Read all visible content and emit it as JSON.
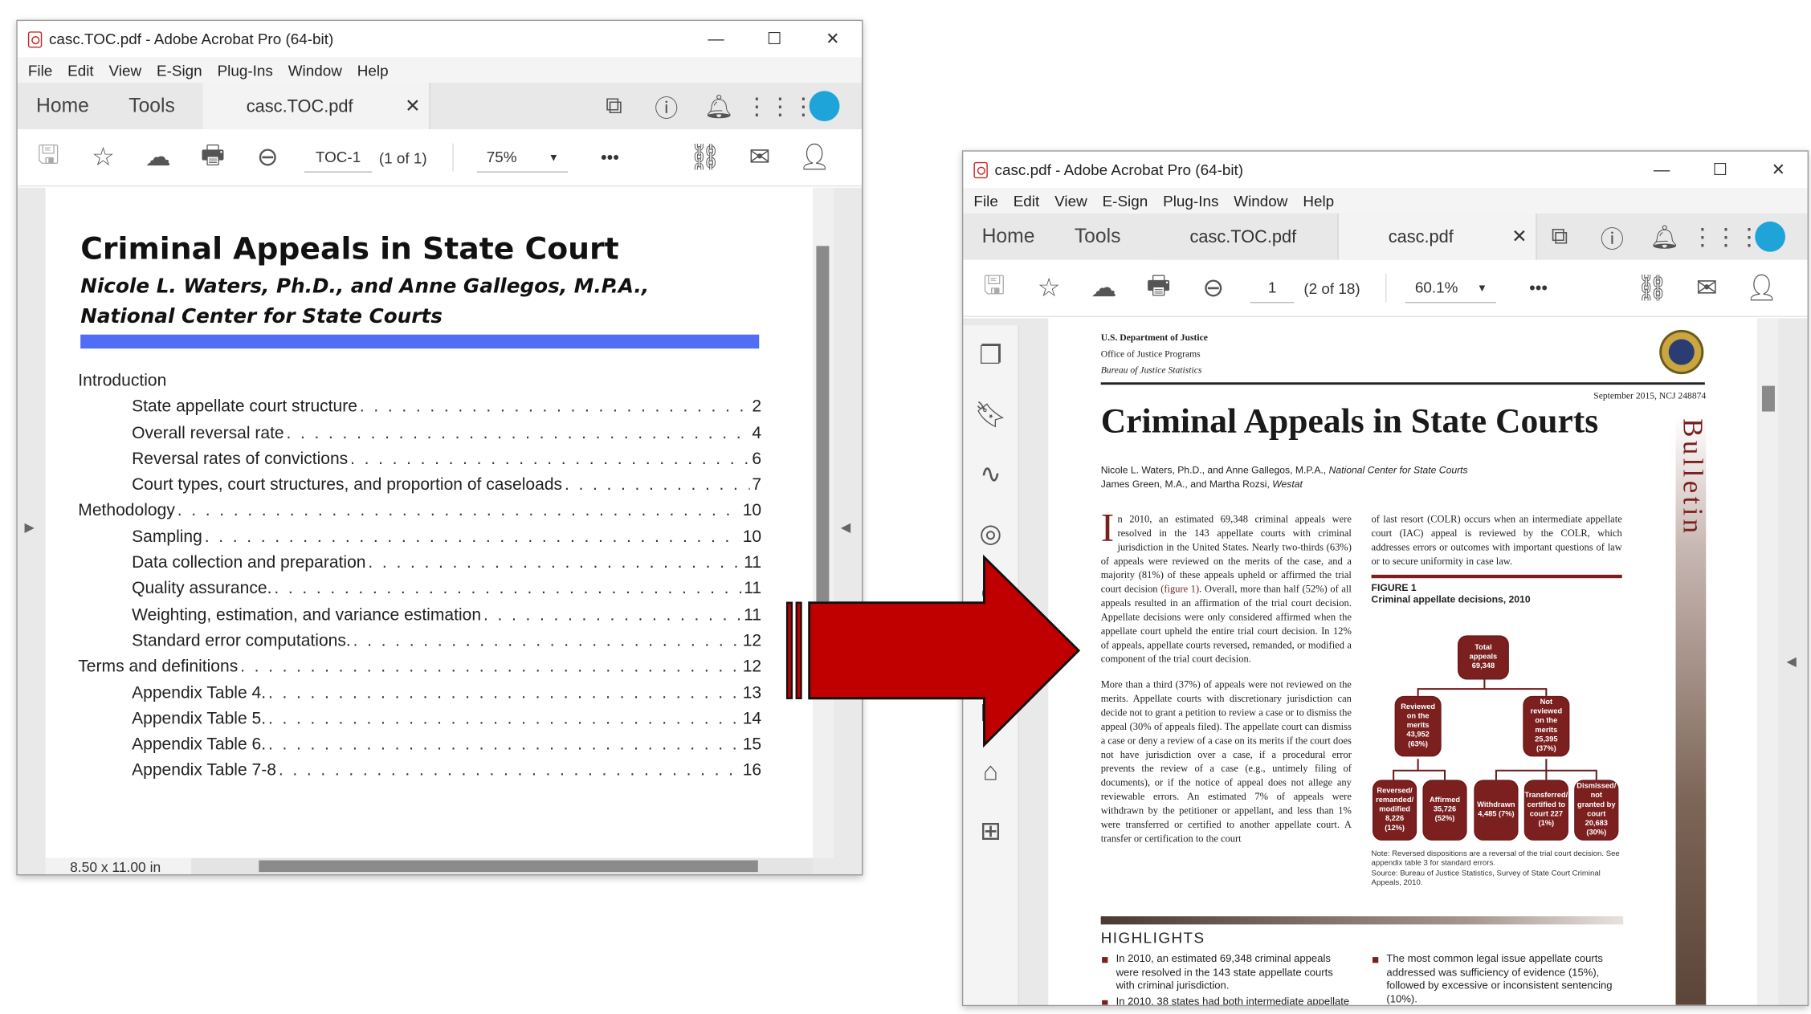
{
  "left_window": {
    "title": "casc.TOC.pdf - Adobe Acrobat Pro (64-bit)",
    "window_controls": [
      "—",
      "☐",
      "✕"
    ],
    "menu": [
      "File",
      "Edit",
      "View",
      "E-Sign",
      "Plug-Ins",
      "Window",
      "Help"
    ],
    "nav_tabs": [
      "Home",
      "Tools"
    ],
    "doc_tab": {
      "label": "casc.TOC.pdf",
      "close": "✕"
    },
    "page_field": "TOC-1",
    "page_count": "(1 of 1)",
    "zoom": "75%",
    "more": "•••",
    "status": "8.50 x 11.00 in",
    "page": {
      "title": "Criminal Appeals in State Court",
      "authors_line1": "Nicole L. Waters, Ph.D., and Anne Gallegos, M.P.A.,",
      "authors_line2": "National Center for State Courts",
      "toc": [
        {
          "text": "Introduction",
          "page": ""
        },
        {
          "text": "State appellate court structure",
          "page": "2"
        },
        {
          "text": "Overall reversal rate",
          "page": "4"
        },
        {
          "text": "Reversal rates of convictions",
          "page": "6"
        },
        {
          "text": "Court types, court structures, and proportion of caseloads",
          "page": "7"
        },
        {
          "text": "Methodology",
          "page": "10"
        },
        {
          "text": "Sampling",
          "page": "10"
        },
        {
          "text": "Data collection and preparation",
          "page": "11"
        },
        {
          "text": "Quality assurance.",
          "page": "11"
        },
        {
          "text": "Weighting, estimation, and variance estimation",
          "page": "11"
        },
        {
          "text": "Standard error computations.",
          "page": "12"
        },
        {
          "text": "Terms and definitions",
          "page": "12"
        },
        {
          "text": "Appendix Table 4.",
          "page": "13"
        },
        {
          "text": "Appendix Table 5.",
          "page": "14"
        },
        {
          "text": "Appendix Table 6.",
          "page": "15"
        },
        {
          "text": "Appendix Table 7-8",
          "page": "16"
        }
      ]
    }
  },
  "right_window": {
    "title": "casc.pdf - Adobe Acrobat Pro (64-bit)",
    "window_controls": [
      "—",
      "☐",
      "✕"
    ],
    "menu": [
      "File",
      "Edit",
      "View",
      "E-Sign",
      "Plug-Ins",
      "Window",
      "Help"
    ],
    "nav_tabs": [
      "Home",
      "Tools"
    ],
    "doc_tab1": {
      "label": "casc.TOC.pdf"
    },
    "doc_tab2": {
      "label": "casc.pdf",
      "close": "✕"
    },
    "page_field": "1",
    "page_count": "(2 of 18)",
    "zoom": "60.1%",
    "more": "•••",
    "page": {
      "agency1": "U.S. Department of Justice",
      "agency2": "Office of Justice Programs",
      "agency3": "Bureau of Justice Statistics",
      "date": "September 2015, NCJ 248874",
      "title": "Criminal Appeals in State Courts",
      "authors1_a": "Nicole L. Waters, Ph.D., and Anne Gallegos, M.P.A., ",
      "authors1_b": "National Center for State Courts",
      "authors2_a": "James Green, M.A., and Martha Rozsi, ",
      "authors2_b": "Westat",
      "bulletin": "Bulletin",
      "dropcap": "I",
      "col1_p1a": "n 2010, an estimated 69,348 criminal appeals were resolved in the 143 appellate courts with criminal jurisdiction in the United States. Nearly two-thirds (63%) of appeals were reviewed on the merits of the case, and a majority (81%) of these appeals upheld or affirmed the trial court decision ",
      "col1_p1link": "(figure 1)",
      "col1_p1b": ". Overall, more than half (52%) of all appeals resulted in an affirmation of the trial court decision. Appellate decisions were only considered affirmed when the appellate court upheld the entire trial court decision. In 12% of appeals, appellate courts reversed, remanded, or modified a component of the trial court decision.",
      "col1_p2": "More than a third (37%) of appeals were not reviewed on the merits. Appellate courts with discretionary jurisdiction can decide not to grant a petition to review a case or to dismiss the appeal (30% of appeals filed). The appellate court can dismiss a case or deny a review of a case on its merits if the court does not have jurisdiction over a case, if a procedural error prevents the review of a case (e.g., untimely filing of documents), or if the notice of appeal does not allege any reviewable errors. An estimated 7% of appeals were withdrawn by the petitioner or appellant, and less than 1% were transferred or certified to another appellate court. A transfer or certification to the court",
      "col2_p1": "of last resort (COLR) occurs when an intermediate appellate court (IAC) appeal is reviewed by the COLR, which addresses errors or outcomes with important questions of law or to secure uniformity in case law.",
      "figure_label": "FIGURE 1",
      "figure_title": "Criminal appellate decisions, 2010",
      "fig_boxes": {
        "total": "Total appeals 69,348",
        "reviewed": "Reviewed on the merits 43,952 (63%)",
        "notreviewed": "Not reviewed on the merits 25,395 (37%)",
        "reversed": "Reversed/ remanded/ modified 8,226 (12%)",
        "affirmed": "Affirmed 35,726 (52%)",
        "withdrawn": "Withdrawn 4,485 (7%)",
        "transferred": "Transferred/ certified to court 227 (1%)",
        "dismissed": "Dismissed/ not granted by court 20,683 (30%)"
      },
      "fig_note1": "Note: Reversed dispositions are a reversal of the trial court decision. See appendix table 3 for standard errors.",
      "fig_note2": "Source: Bureau of Justice Statistics, Survey of State Court Criminal Appeals, 2010.",
      "highlights_title": "HIGHLIGHTS",
      "highlights": [
        "In 2010, an estimated 69,348 criminal appeals were resolved in the 143 state appellate courts with criminal jurisdiction.",
        "In 2010, 38 states had both intermediate appellate",
        "The most common legal issue appellate courts addressed was sufficiency of evidence (15%), followed by excessive or inconsistent sentencing (10%)."
      ]
    }
  },
  "colors": {
    "arrow": "#c00000",
    "toc_bar": "#4f6df5",
    "bjs_maroon": "#7b1f1f",
    "avatar": "#1ea4d9"
  }
}
